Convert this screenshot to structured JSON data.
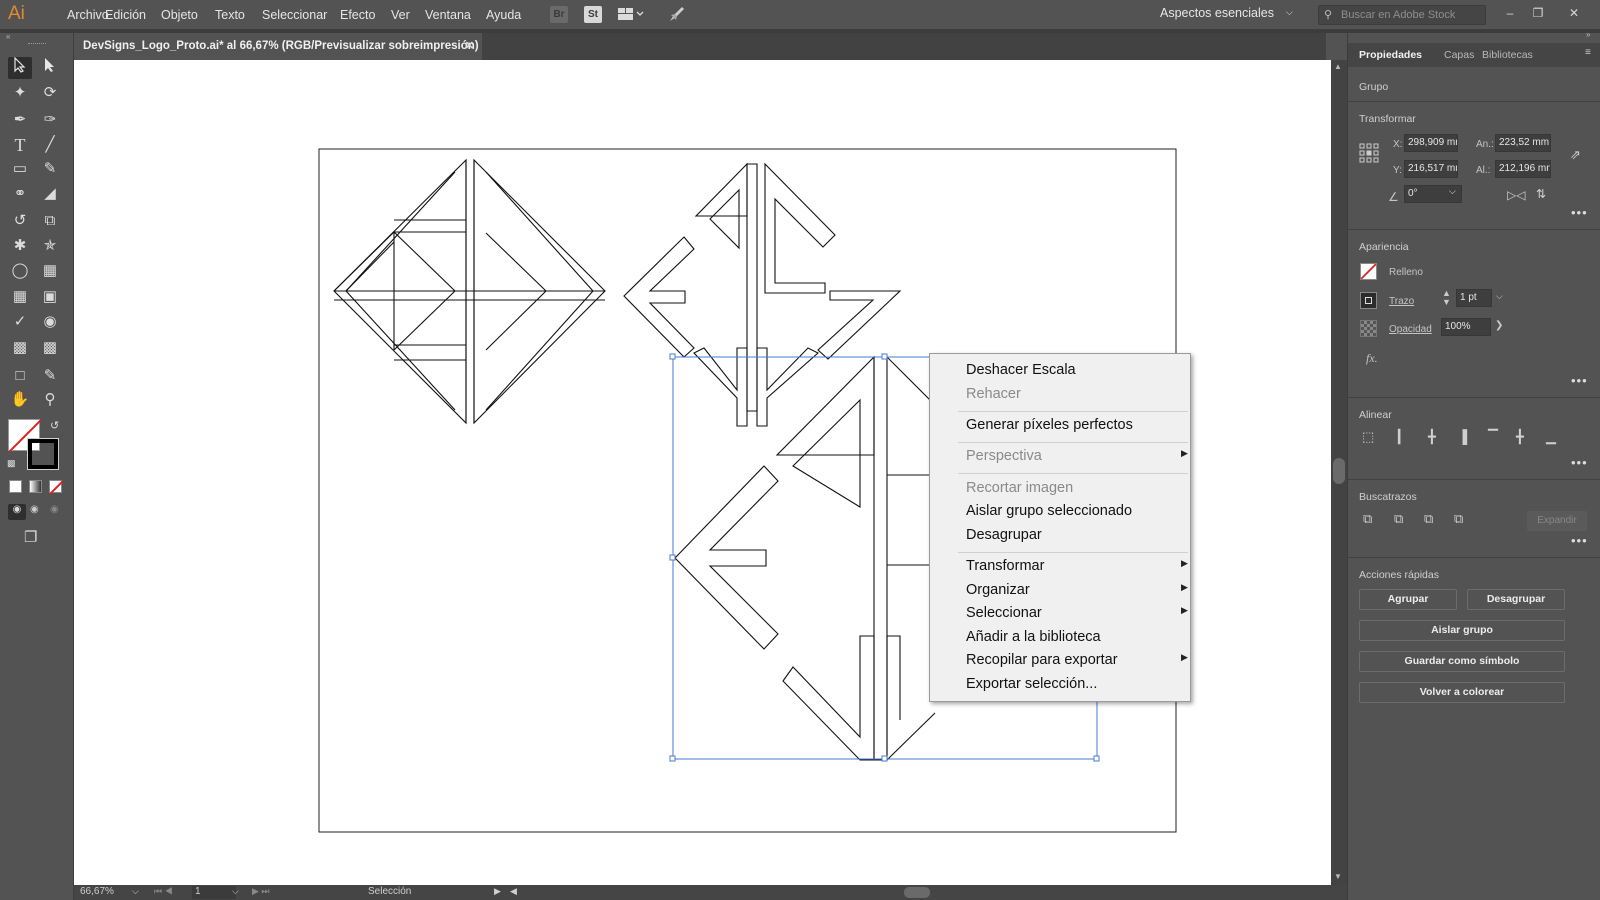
{
  "app": {
    "logo": "Ai",
    "menus": [
      "Archivo",
      "Edición",
      "Objeto",
      "Texto",
      "Seleccionar",
      "Efecto",
      "Ver",
      "Ventana",
      "Ayuda"
    ],
    "bridge_label": "Br",
    "stock_label": "St",
    "workspace": "Aspectos esenciales",
    "search_placeholder": "Buscar en Adobe Stock"
  },
  "document": {
    "tab_title": "DevSigns_Logo_Proto.ai* al 66,67% (RGB/Previsualizar sobreimpresión)"
  },
  "status": {
    "zoom": "66,67%",
    "artboard": "1",
    "tool": "Selección"
  },
  "context_menu": {
    "items": [
      {
        "label": "Deshacer Escala",
        "enabled": true
      },
      {
        "label": "Rehacer",
        "enabled": false
      },
      {
        "label": "Generar píxeles perfectos",
        "enabled": true
      },
      {
        "label": "Perspectiva",
        "enabled": false,
        "submenu": true
      },
      {
        "label": "Recortar imagen",
        "enabled": false
      },
      {
        "label": "Aislar grupo seleccionado",
        "enabled": true
      },
      {
        "label": "Desagrupar",
        "enabled": true
      },
      {
        "label": "Transformar",
        "enabled": true,
        "submenu": true
      },
      {
        "label": "Organizar",
        "enabled": true,
        "submenu": true
      },
      {
        "label": "Seleccionar",
        "enabled": true,
        "submenu": true
      },
      {
        "label": "Añadir a la biblioteca",
        "enabled": true
      },
      {
        "label": "Recopilar para exportar",
        "enabled": true,
        "submenu": true
      },
      {
        "label": "Exportar selección...",
        "enabled": true
      }
    ]
  },
  "properties": {
    "tabs": [
      "Propiedades",
      "Capas",
      "Bibliotecas"
    ],
    "object_type": "Grupo",
    "transform": {
      "title": "Transformar",
      "x_label": "X:",
      "x": "298,909 mn",
      "y_label": "Y:",
      "y": "216,517 mn",
      "w_label": "An.:",
      "w": "223,52 mm",
      "h_label": "Al.:",
      "h": "212,196 mn",
      "angle": "0°"
    },
    "appearance": {
      "title": "Apariencia",
      "fill_label": "Relleno",
      "stroke_label": "Trazo",
      "stroke_value": "1 pt",
      "opacity_label": "Opacidad",
      "opacity_value": "100%",
      "fx_label": "fx."
    },
    "align": {
      "title": "Alinear"
    },
    "pathfinder": {
      "title": "Buscatrazos",
      "expand_label": "Expandir"
    },
    "quick_actions": {
      "title": "Acciones rápidas",
      "group": "Agrupar",
      "ungroup": "Desagrupar",
      "isolate": "Aislar grupo",
      "save_symbol": "Guardar como símbolo",
      "recolor": "Volver a colorear"
    }
  },
  "colors": {
    "accent_selection": "#4a78d6",
    "chrome": "#535353",
    "logo_orange": "#e08a2c"
  }
}
